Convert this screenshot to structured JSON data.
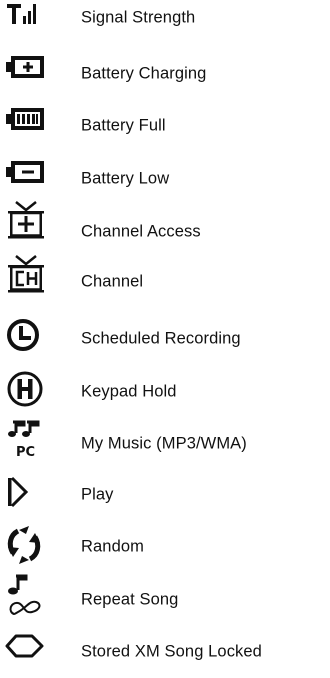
{
  "legend": {
    "items": [
      {
        "icon": "signal-strength-icon",
        "label": "Signal Strength"
      },
      {
        "icon": "battery-charging-icon",
        "label": "Battery Charging"
      },
      {
        "icon": "battery-full-icon",
        "label": "Battery Full"
      },
      {
        "icon": "battery-low-icon",
        "label": "Battery Low"
      },
      {
        "icon": "channel-access-icon",
        "label": "Channel Access"
      },
      {
        "icon": "channel-icon",
        "label": "Channel"
      },
      {
        "icon": "clock-icon",
        "label": "Scheduled Recording"
      },
      {
        "icon": "hold-icon",
        "label": "Keypad Hold"
      },
      {
        "icon": "music-pc-icon",
        "label": "My Music (MP3/WMA)"
      },
      {
        "icon": "play-icon",
        "label": "Play"
      },
      {
        "icon": "random-icon",
        "label": "Random"
      },
      {
        "icon": "repeat-song-icon",
        "label": "Repeat Song"
      },
      {
        "icon": "xm-song-locked-icon",
        "label": "Stored XM Song Locked"
      }
    ]
  }
}
